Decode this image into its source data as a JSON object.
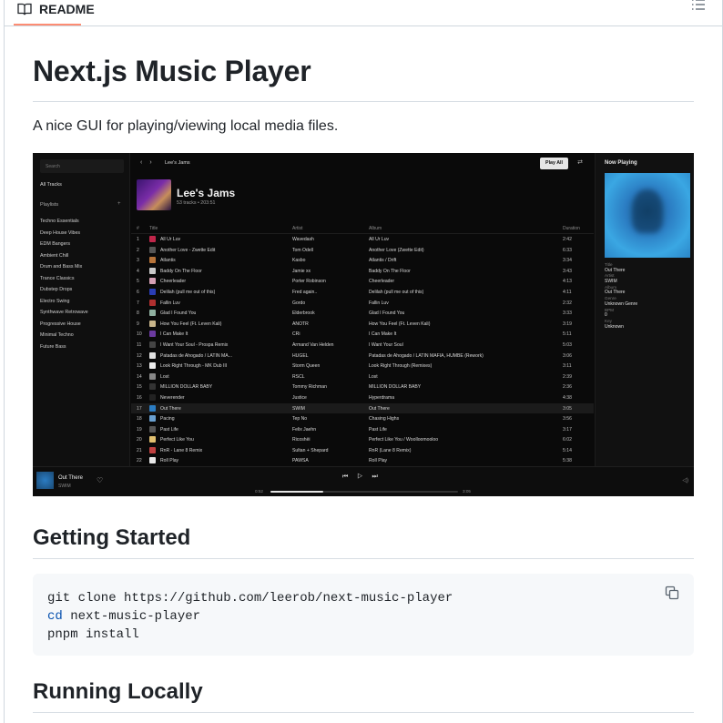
{
  "readme_tab": {
    "label": "README"
  },
  "title": "Next.js Music Player",
  "description": "A nice GUI for playing/viewing local media files.",
  "app": {
    "search_placeholder": "Search",
    "all_tracks": "All Tracks",
    "playlists_label": "Playlists",
    "playlists": [
      "Techno Essentials",
      "Deep House Vibes",
      "EDM Bangers",
      "Ambient Chill",
      "Drum and Bass Mix",
      "Trance Classics",
      "Dubstep Drops",
      "Electro Swing",
      "Synthwave Retrowave",
      "Progressive House",
      "Minimal Techno",
      "Future Bass"
    ],
    "breadcrumb": "Lee's Jams",
    "play_all": "Play All",
    "playlist_title": "Lee's Jams",
    "playlist_meta": "53 tracks • 203:51",
    "columns": {
      "num": "#",
      "title": "Title",
      "artist": "Artist",
      "album": "Album",
      "duration": "Duration"
    },
    "tracks": [
      {
        "n": "1",
        "title": "All Ur Luv",
        "artist": "Wavedash",
        "album": "All Ur Luv",
        "dur": "2:42",
        "color": "#c0264a"
      },
      {
        "n": "2",
        "title": "Another Love - Zwette Edit",
        "artist": "Tom Odell",
        "album": "Another Love (Zwette Edit)",
        "dur": "6:33",
        "color": "#555"
      },
      {
        "n": "3",
        "title": "Atlantis",
        "artist": "Kasbo",
        "album": "Atlantis / Drift",
        "dur": "3:34",
        "color": "#b8743a"
      },
      {
        "n": "4",
        "title": "Baddy On The Floor",
        "artist": "Jamie xx",
        "album": "Baddy On The Floor",
        "dur": "3:43",
        "color": "#c9c9c9"
      },
      {
        "n": "5",
        "title": "Cheerleader",
        "artist": "Porter Robinson",
        "album": "Cheerleader",
        "dur": "4:13",
        "color": "#d6a0b5"
      },
      {
        "n": "6",
        "title": "Delilah (pull me out of this)",
        "artist": "Fred again..",
        "album": "Delilah (pull me out of this)",
        "dur": "4:11",
        "color": "#2a3db5"
      },
      {
        "n": "7",
        "title": "Fallin Luv",
        "artist": "Gordo",
        "album": "Fallin Luv",
        "dur": "2:32",
        "color": "#b03030"
      },
      {
        "n": "8",
        "title": "Glad I Found You",
        "artist": "Elderbrook",
        "album": "Glad I Found You",
        "dur": "3:33",
        "color": "#8fb0a0"
      },
      {
        "n": "9",
        "title": "How You Feel (Ft. Leven Kali)",
        "artist": "ANOTR",
        "album": "How You Feel (Ft. Leven Kali)",
        "dur": "3:19",
        "color": "#c8b58a"
      },
      {
        "n": "10",
        "title": "I Can Make It",
        "artist": "CRi",
        "album": "I Can Make It",
        "dur": "5:11",
        "color": "#6b3aa0"
      },
      {
        "n": "11",
        "title": "I Want Your Soul - Prospa Remix",
        "artist": "Armand Van Helden",
        "album": "I Want Your Soul",
        "dur": "5:03",
        "color": "#444"
      },
      {
        "n": "12",
        "title": "Patadas de Ahogado / LATÏN MA...",
        "artist": "HUGEL",
        "album": "Patadas de Ahogado / LATÏN MAFIA, HUMBE (Rework)",
        "dur": "3:06",
        "color": "#e0e0e0"
      },
      {
        "n": "13",
        "title": "Look Right Through - MK Dub III",
        "artist": "Storm Queen",
        "album": "Look Right Through (Remixes)",
        "dur": "3:11",
        "color": "#eee"
      },
      {
        "n": "14",
        "title": "Lost",
        "artist": "RSCL",
        "album": "Lost",
        "dur": "2:39",
        "color": "#888"
      },
      {
        "n": "15",
        "title": "MILLION DOLLAR BABY",
        "artist": "Tommy Richman",
        "album": "MILLION DOLLAR BABY",
        "dur": "2:36",
        "color": "#333"
      },
      {
        "n": "16",
        "title": "Neverender",
        "artist": "Justice",
        "album": "Hyperdrama",
        "dur": "4:38",
        "color": "#222"
      },
      {
        "n": "17",
        "title": "Out There",
        "artist": "SWIM",
        "album": "Out There",
        "dur": "3:05",
        "color": "#2b7cc2"
      },
      {
        "n": "18",
        "title": "Pacing",
        "artist": "Tep No",
        "album": "Chasing Highs",
        "dur": "3:56",
        "color": "#6aa0d0"
      },
      {
        "n": "19",
        "title": "Past Life",
        "artist": "Felix Jaehn",
        "album": "Past Life",
        "dur": "3:17",
        "color": "#555"
      },
      {
        "n": "20",
        "title": "Perfect Like You",
        "artist": "Ricoshëi",
        "album": "Perfect Like You / Woolloomooloo",
        "dur": "6:02",
        "color": "#e0c070"
      },
      {
        "n": "21",
        "title": "RnR - Lane 8 Remix",
        "artist": "Sultan + Shepard",
        "album": "RnR (Lane 8 Remix)",
        "dur": "5:14",
        "color": "#c04040"
      },
      {
        "n": "22",
        "title": "Roll Play",
        "artist": "PAWSA",
        "album": "Roll Play",
        "dur": "5:38",
        "color": "#e8e8e8"
      }
    ],
    "now_playing": {
      "header": "Now Playing",
      "fields": [
        {
          "label": "Title",
          "value": "Out There"
        },
        {
          "label": "Artist",
          "value": "SWIM"
        },
        {
          "label": "Album",
          "value": "Out There"
        },
        {
          "label": "Genre",
          "value": "Unknown Genre"
        },
        {
          "label": "BPM",
          "value": "0"
        },
        {
          "label": "Key",
          "value": "Unknown"
        }
      ]
    },
    "player": {
      "title": "Out There",
      "artist": "SWIM",
      "elapsed": "0:52",
      "total": "3:05",
      "progress": 0.28
    }
  },
  "sections": {
    "getting_started": "Getting Started",
    "running_locally": "Running Locally"
  },
  "code": {
    "line1": "git clone https://github.com/leerob/next-music-player",
    "line2_kw": "cd",
    "line2_rest": " next-music-player",
    "line3": "pnpm install"
  }
}
